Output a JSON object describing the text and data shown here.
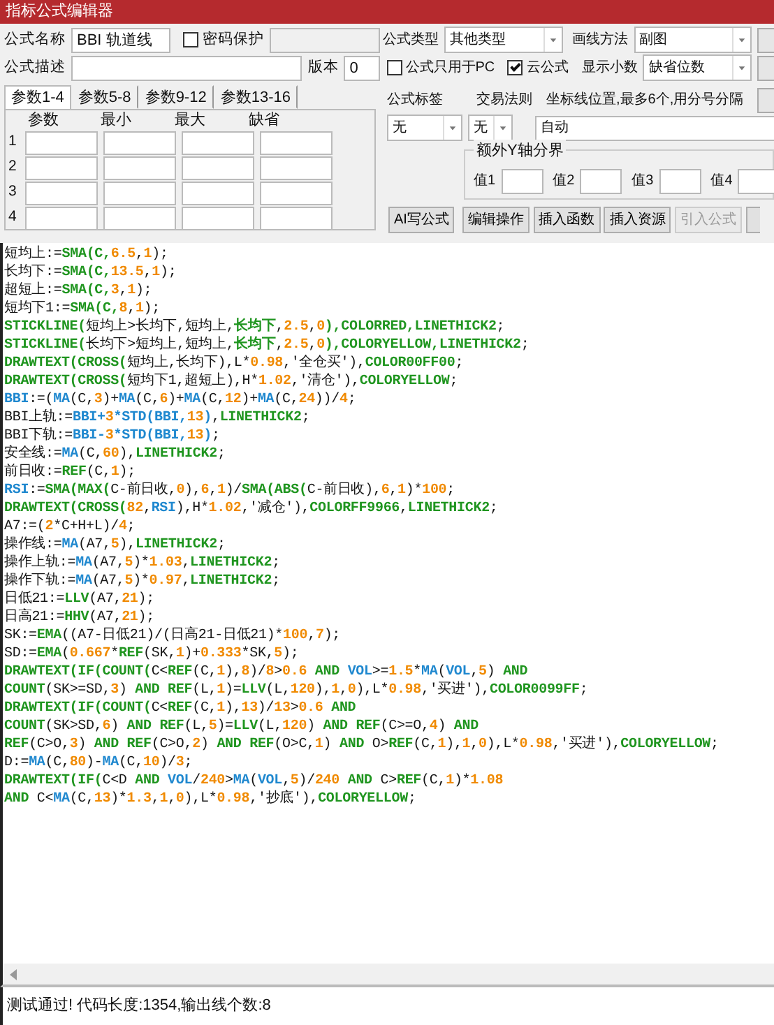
{
  "window": {
    "title": "指标公式编辑器"
  },
  "form": {
    "name": {
      "label": "公式名称",
      "value": "BBI 轨道线"
    },
    "password": {
      "label": "密码保护",
      "checked": false
    },
    "description": {
      "label": "公式描述"
    },
    "version": {
      "label": "版本",
      "value": "0"
    },
    "type": {
      "label": "公式类型",
      "value": "其他类型"
    },
    "draw_method": {
      "label": "画线方法",
      "value": "副图"
    },
    "pc_only": {
      "label": "公式只用于PC",
      "checked": false
    },
    "cloud": {
      "label": "云公式",
      "checked": true
    },
    "decimals": {
      "label": "显示小数",
      "value": "缺省位数"
    },
    "tag": {
      "label": "公式标签",
      "value": "无"
    },
    "trade_rule": {
      "label": "交易法则",
      "value": "无"
    },
    "axis_position": {
      "label": "坐标线位置,最多6个,用分号分隔",
      "value": "自动"
    }
  },
  "param_tabs": [
    {
      "label": "参数1-4",
      "selected": true
    },
    {
      "label": "参数5-8",
      "selected": false
    },
    {
      "label": "参数9-12",
      "selected": false
    },
    {
      "label": "参数13-16",
      "selected": false
    }
  ],
  "param_table": {
    "columns": [
      "参数",
      "最小",
      "最大",
      "缺省"
    ],
    "rows": [
      "1",
      "2",
      "3",
      "4"
    ]
  },
  "y_axis_bounds": {
    "legend": "额外Y轴分界",
    "fields": [
      "值1",
      "值2",
      "值3",
      "值4"
    ]
  },
  "buttons": [
    {
      "label": "AI写公式",
      "disabled": false
    },
    {
      "label": "编辑操作",
      "disabled": false
    },
    {
      "label": "插入函数",
      "disabled": false
    },
    {
      "label": "插入资源",
      "disabled": false
    },
    {
      "label": "引入公式",
      "disabled": true
    }
  ],
  "code_lines": [
    [
      {
        "kind": "plain",
        "text": "短均上:="
      },
      {
        "kind": "function",
        "text": "SMA(C,"
      },
      {
        "kind": "number",
        "text": "6.5"
      },
      {
        "kind": "plain",
        "text": ","
      },
      {
        "kind": "number",
        "text": "1"
      },
      {
        "kind": "plain",
        "text": ");"
      }
    ],
    [
      {
        "kind": "plain",
        "text": "长均下:="
      },
      {
        "kind": "function",
        "text": "SMA(C,"
      },
      {
        "kind": "number",
        "text": "13.5"
      },
      {
        "kind": "plain",
        "text": ","
      },
      {
        "kind": "number",
        "text": "1"
      },
      {
        "kind": "plain",
        "text": ");"
      }
    ],
    [
      {
        "kind": "plain",
        "text": "超短上:="
      },
      {
        "kind": "function",
        "text": "SMA(C,"
      },
      {
        "kind": "number",
        "text": "3"
      },
      {
        "kind": "plain",
        "text": ","
      },
      {
        "kind": "number",
        "text": "1"
      },
      {
        "kind": "plain",
        "text": ");"
      }
    ],
    [
      {
        "kind": "plain",
        "text": "短均下1:="
      },
      {
        "kind": "function",
        "text": "SMA(C,"
      },
      {
        "kind": "number",
        "text": "8"
      },
      {
        "kind": "plain",
        "text": ","
      },
      {
        "kind": "number",
        "text": "1"
      },
      {
        "kind": "plain",
        "text": ");"
      }
    ],
    [
      {
        "kind": "function",
        "text": "STICKLINE("
      },
      {
        "kind": "plain",
        "text": "短均上>长均下,短均上,"
      },
      {
        "kind": "function",
        "text": "长均下"
      },
      {
        "kind": "plain",
        "text": ","
      },
      {
        "kind": "number",
        "text": "2.5"
      },
      {
        "kind": "plain",
        "text": ","
      },
      {
        "kind": "number",
        "text": "0"
      },
      {
        "kind": "function",
        "text": "),COLORRED,LINETHICK2"
      },
      {
        "kind": "plain",
        "text": ";"
      }
    ],
    [
      {
        "kind": "function",
        "text": "STICKLINE("
      },
      {
        "kind": "plain",
        "text": "长均下>短均上,短均上,"
      },
      {
        "kind": "function",
        "text": "长均下"
      },
      {
        "kind": "plain",
        "text": ","
      },
      {
        "kind": "number",
        "text": "2.5"
      },
      {
        "kind": "plain",
        "text": ","
      },
      {
        "kind": "number",
        "text": "0"
      },
      {
        "kind": "function",
        "text": "),COLORYELLOW,LINETHICK2"
      },
      {
        "kind": "plain",
        "text": ";"
      }
    ],
    [
      {
        "kind": "function",
        "text": "DRAWTEXT(CROSS("
      },
      {
        "kind": "plain",
        "text": "短均上,长均下),L*"
      },
      {
        "kind": "number",
        "text": "0.98"
      },
      {
        "kind": "plain",
        "text": ",'全仓买'),"
      },
      {
        "kind": "function",
        "text": "COLOR00FF00"
      },
      {
        "kind": "plain",
        "text": ";"
      }
    ],
    [
      {
        "kind": "function",
        "text": "DRAWTEXT(CROSS("
      },
      {
        "kind": "plain",
        "text": "短均下1,超短上),H*"
      },
      {
        "kind": "number",
        "text": "1.02"
      },
      {
        "kind": "plain",
        "text": ",'清仓'),"
      },
      {
        "kind": "function",
        "text": "COLORYELLOW"
      },
      {
        "kind": "plain",
        "text": ";"
      }
    ],
    [
      {
        "kind": "variable",
        "text": "BBI"
      },
      {
        "kind": "plain",
        "text": ":=("
      },
      {
        "kind": "variable",
        "text": "MA"
      },
      {
        "kind": "plain",
        "text": "(C,"
      },
      {
        "kind": "number",
        "text": "3"
      },
      {
        "kind": "plain",
        "text": ")+"
      },
      {
        "kind": "variable",
        "text": "MA"
      },
      {
        "kind": "plain",
        "text": "(C,"
      },
      {
        "kind": "number",
        "text": "6"
      },
      {
        "kind": "plain",
        "text": ")+"
      },
      {
        "kind": "variable",
        "text": "MA"
      },
      {
        "kind": "plain",
        "text": "(C,"
      },
      {
        "kind": "number",
        "text": "12"
      },
      {
        "kind": "plain",
        "text": ")+"
      },
      {
        "kind": "variable",
        "text": "MA"
      },
      {
        "kind": "plain",
        "text": "(C,"
      },
      {
        "kind": "number",
        "text": "24"
      },
      {
        "kind": "plain",
        "text": "))/"
      },
      {
        "kind": "number",
        "text": "4"
      },
      {
        "kind": "plain",
        "text": ";"
      }
    ],
    [
      {
        "kind": "plain",
        "text": "BBI上轨:="
      },
      {
        "kind": "variable",
        "text": "BBI+"
      },
      {
        "kind": "number",
        "text": "3"
      },
      {
        "kind": "variable",
        "text": "*STD(BBI,"
      },
      {
        "kind": "number",
        "text": "13"
      },
      {
        "kind": "variable",
        "text": ")"
      },
      {
        "kind": "plain",
        "text": ","
      },
      {
        "kind": "function",
        "text": "LINETHICK2"
      },
      {
        "kind": "plain",
        "text": ";"
      }
    ],
    [
      {
        "kind": "plain",
        "text": "BBI下轨:="
      },
      {
        "kind": "variable",
        "text": "BBI-"
      },
      {
        "kind": "number",
        "text": "3"
      },
      {
        "kind": "variable",
        "text": "*STD(BBI,"
      },
      {
        "kind": "number",
        "text": "13"
      },
      {
        "kind": "variable",
        "text": ")"
      },
      {
        "kind": "plain",
        "text": ";"
      }
    ],
    [
      {
        "kind": "plain",
        "text": "安全线:="
      },
      {
        "kind": "variable",
        "text": "MA"
      },
      {
        "kind": "plain",
        "text": "(C,"
      },
      {
        "kind": "number",
        "text": "60"
      },
      {
        "kind": "plain",
        "text": "),"
      },
      {
        "kind": "function",
        "text": "LINETHICK2"
      },
      {
        "kind": "plain",
        "text": ";"
      }
    ],
    [
      {
        "kind": "plain",
        "text": "前日收:="
      },
      {
        "kind": "function",
        "text": "REF"
      },
      {
        "kind": "plain",
        "text": "(C,"
      },
      {
        "kind": "number",
        "text": "1"
      },
      {
        "kind": "plain",
        "text": ");"
      }
    ],
    [
      {
        "kind": "variable",
        "text": "RSI"
      },
      {
        "kind": "plain",
        "text": ":="
      },
      {
        "kind": "function",
        "text": "SMA(MAX("
      },
      {
        "kind": "plain",
        "text": "C-前日收,"
      },
      {
        "kind": "number",
        "text": "0"
      },
      {
        "kind": "plain",
        "text": "),"
      },
      {
        "kind": "number",
        "text": "6"
      },
      {
        "kind": "plain",
        "text": ","
      },
      {
        "kind": "number",
        "text": "1"
      },
      {
        "kind": "plain",
        "text": ")/"
      },
      {
        "kind": "function",
        "text": "SMA(ABS("
      },
      {
        "kind": "plain",
        "text": "C-前日收),"
      },
      {
        "kind": "number",
        "text": "6"
      },
      {
        "kind": "plain",
        "text": ","
      },
      {
        "kind": "number",
        "text": "1"
      },
      {
        "kind": "plain",
        "text": ")*"
      },
      {
        "kind": "number",
        "text": "100"
      },
      {
        "kind": "plain",
        "text": ";"
      }
    ],
    [
      {
        "kind": "function",
        "text": "DRAWTEXT(CROSS("
      },
      {
        "kind": "number",
        "text": "82"
      },
      {
        "kind": "plain",
        "text": ","
      },
      {
        "kind": "variable",
        "text": "RSI"
      },
      {
        "kind": "plain",
        "text": "),H*"
      },
      {
        "kind": "number",
        "text": "1.02"
      },
      {
        "kind": "plain",
        "text": ",'减仓'),"
      },
      {
        "kind": "function",
        "text": "COLORFF9966"
      },
      {
        "kind": "plain",
        "text": ","
      },
      {
        "kind": "function",
        "text": "LINETHICK2"
      },
      {
        "kind": "plain",
        "text": ";"
      }
    ],
    [
      {
        "kind": "plain",
        "text": "A7:=("
      },
      {
        "kind": "number",
        "text": "2"
      },
      {
        "kind": "plain",
        "text": "*C+H+L)/"
      },
      {
        "kind": "number",
        "text": "4"
      },
      {
        "kind": "plain",
        "text": ";"
      }
    ],
    [
      {
        "kind": "plain",
        "text": "操作线:="
      },
      {
        "kind": "variable",
        "text": "MA"
      },
      {
        "kind": "plain",
        "text": "(A7,"
      },
      {
        "kind": "number",
        "text": "5"
      },
      {
        "kind": "plain",
        "text": "),"
      },
      {
        "kind": "function",
        "text": "LINETHICK2"
      },
      {
        "kind": "plain",
        "text": ";"
      }
    ],
    [
      {
        "kind": "plain",
        "text": "操作上轨:="
      },
      {
        "kind": "variable",
        "text": "MA"
      },
      {
        "kind": "plain",
        "text": "(A7,"
      },
      {
        "kind": "number",
        "text": "5"
      },
      {
        "kind": "plain",
        "text": ")*"
      },
      {
        "kind": "number",
        "text": "1.03"
      },
      {
        "kind": "plain",
        "text": ","
      },
      {
        "kind": "function",
        "text": "LINETHICK2"
      },
      {
        "kind": "plain",
        "text": ";"
      }
    ],
    [
      {
        "kind": "plain",
        "text": "操作下轨:="
      },
      {
        "kind": "variable",
        "text": "MA"
      },
      {
        "kind": "plain",
        "text": "(A7,"
      },
      {
        "kind": "number",
        "text": "5"
      },
      {
        "kind": "plain",
        "text": ")*"
      },
      {
        "kind": "number",
        "text": "0.97"
      },
      {
        "kind": "plain",
        "text": ","
      },
      {
        "kind": "function",
        "text": "LINETHICK2"
      },
      {
        "kind": "plain",
        "text": ";"
      }
    ],
    [
      {
        "kind": "plain",
        "text": "日低21:="
      },
      {
        "kind": "function",
        "text": "LLV"
      },
      {
        "kind": "plain",
        "text": "(A7,"
      },
      {
        "kind": "number",
        "text": "21"
      },
      {
        "kind": "plain",
        "text": ");"
      }
    ],
    [
      {
        "kind": "plain",
        "text": "日高21:="
      },
      {
        "kind": "function",
        "text": "HHV"
      },
      {
        "kind": "plain",
        "text": "(A7,"
      },
      {
        "kind": "number",
        "text": "21"
      },
      {
        "kind": "plain",
        "text": ");"
      }
    ],
    [
      {
        "kind": "plain",
        "text": "SK:="
      },
      {
        "kind": "function",
        "text": "EMA"
      },
      {
        "kind": "plain",
        "text": "((A7-日低21)/(日高21-日低21)*"
      },
      {
        "kind": "number",
        "text": "100"
      },
      {
        "kind": "plain",
        "text": ","
      },
      {
        "kind": "number",
        "text": "7"
      },
      {
        "kind": "plain",
        "text": ");"
      }
    ],
    [
      {
        "kind": "plain",
        "text": "SD:="
      },
      {
        "kind": "function",
        "text": "EMA"
      },
      {
        "kind": "plain",
        "text": "("
      },
      {
        "kind": "number",
        "text": "0.667"
      },
      {
        "kind": "plain",
        "text": "*"
      },
      {
        "kind": "function",
        "text": "REF"
      },
      {
        "kind": "plain",
        "text": "(SK,"
      },
      {
        "kind": "number",
        "text": "1"
      },
      {
        "kind": "plain",
        "text": ")+"
      },
      {
        "kind": "number",
        "text": "0.333"
      },
      {
        "kind": "plain",
        "text": "*SK,"
      },
      {
        "kind": "number",
        "text": "5"
      },
      {
        "kind": "plain",
        "text": ");"
      }
    ],
    [
      {
        "kind": "function",
        "text": "DRAWTEXT(IF(COUNT("
      },
      {
        "kind": "plain",
        "text": "C<"
      },
      {
        "kind": "function",
        "text": "REF"
      },
      {
        "kind": "plain",
        "text": "(C,"
      },
      {
        "kind": "number",
        "text": "1"
      },
      {
        "kind": "plain",
        "text": "),"
      },
      {
        "kind": "number",
        "text": "8"
      },
      {
        "kind": "plain",
        "text": ")/"
      },
      {
        "kind": "number",
        "text": "8"
      },
      {
        "kind": "plain",
        "text": ">"
      },
      {
        "kind": "number",
        "text": "0.6"
      },
      {
        "kind": "function",
        "text": " AND "
      },
      {
        "kind": "variable",
        "text": "VOL"
      },
      {
        "kind": "plain",
        "text": ">="
      },
      {
        "kind": "number",
        "text": "1.5"
      },
      {
        "kind": "plain",
        "text": "*"
      },
      {
        "kind": "variable",
        "text": "MA"
      },
      {
        "kind": "plain",
        "text": "("
      },
      {
        "kind": "variable",
        "text": "VOL"
      },
      {
        "kind": "plain",
        "text": ","
      },
      {
        "kind": "number",
        "text": "5"
      },
      {
        "kind": "plain",
        "text": ")"
      },
      {
        "kind": "function",
        "text": " AND"
      }
    ],
    [
      {
        "kind": "function",
        "text": "COUNT"
      },
      {
        "kind": "plain",
        "text": "(SK>=SD,"
      },
      {
        "kind": "number",
        "text": "3"
      },
      {
        "kind": "plain",
        "text": ")"
      },
      {
        "kind": "function",
        "text": " AND REF"
      },
      {
        "kind": "plain",
        "text": "(L,"
      },
      {
        "kind": "number",
        "text": "1"
      },
      {
        "kind": "plain",
        "text": ")="
      },
      {
        "kind": "function",
        "text": "LLV"
      },
      {
        "kind": "plain",
        "text": "(L,"
      },
      {
        "kind": "number",
        "text": "120"
      },
      {
        "kind": "plain",
        "text": "),"
      },
      {
        "kind": "number",
        "text": "1"
      },
      {
        "kind": "plain",
        "text": ","
      },
      {
        "kind": "number",
        "text": "0"
      },
      {
        "kind": "plain",
        "text": "),L*"
      },
      {
        "kind": "number",
        "text": "0.98"
      },
      {
        "kind": "plain",
        "text": ",'买进'),"
      },
      {
        "kind": "function",
        "text": "COLOR0099FF"
      },
      {
        "kind": "plain",
        "text": ";"
      }
    ],
    [
      {
        "kind": "function",
        "text": "DRAWTEXT(IF(COUNT("
      },
      {
        "kind": "plain",
        "text": "C<"
      },
      {
        "kind": "function",
        "text": "REF"
      },
      {
        "kind": "plain",
        "text": "(C,"
      },
      {
        "kind": "number",
        "text": "1"
      },
      {
        "kind": "plain",
        "text": "),"
      },
      {
        "kind": "number",
        "text": "13"
      },
      {
        "kind": "plain",
        "text": ")/"
      },
      {
        "kind": "number",
        "text": "13"
      },
      {
        "kind": "plain",
        "text": ">"
      },
      {
        "kind": "number",
        "text": "0.6"
      },
      {
        "kind": "function",
        "text": " AND"
      }
    ],
    [
      {
        "kind": "function",
        "text": "COUNT"
      },
      {
        "kind": "plain",
        "text": "(SK>SD,"
      },
      {
        "kind": "number",
        "text": "6"
      },
      {
        "kind": "plain",
        "text": ")"
      },
      {
        "kind": "function",
        "text": " AND REF"
      },
      {
        "kind": "plain",
        "text": "(L,"
      },
      {
        "kind": "number",
        "text": "5"
      },
      {
        "kind": "plain",
        "text": ")="
      },
      {
        "kind": "function",
        "text": "LLV"
      },
      {
        "kind": "plain",
        "text": "(L,"
      },
      {
        "kind": "number",
        "text": "120"
      },
      {
        "kind": "plain",
        "text": ")"
      },
      {
        "kind": "function",
        "text": " AND REF"
      },
      {
        "kind": "plain",
        "text": "(C>=O,"
      },
      {
        "kind": "number",
        "text": "4"
      },
      {
        "kind": "plain",
        "text": ")"
      },
      {
        "kind": "function",
        "text": " AND"
      }
    ],
    [
      {
        "kind": "function",
        "text": "REF"
      },
      {
        "kind": "plain",
        "text": "(C>O,"
      },
      {
        "kind": "number",
        "text": "3"
      },
      {
        "kind": "plain",
        "text": ")"
      },
      {
        "kind": "function",
        "text": " AND REF"
      },
      {
        "kind": "plain",
        "text": "(C>O,"
      },
      {
        "kind": "number",
        "text": "2"
      },
      {
        "kind": "plain",
        "text": ")"
      },
      {
        "kind": "function",
        "text": " AND REF"
      },
      {
        "kind": "plain",
        "text": "(O>C,"
      },
      {
        "kind": "number",
        "text": "1"
      },
      {
        "kind": "plain",
        "text": ")"
      },
      {
        "kind": "function",
        "text": " AND "
      },
      {
        "kind": "plain",
        "text": "O>"
      },
      {
        "kind": "function",
        "text": "REF"
      },
      {
        "kind": "plain",
        "text": "(C,"
      },
      {
        "kind": "number",
        "text": "1"
      },
      {
        "kind": "plain",
        "text": "),"
      },
      {
        "kind": "number",
        "text": "1"
      },
      {
        "kind": "plain",
        "text": ","
      },
      {
        "kind": "number",
        "text": "0"
      },
      {
        "kind": "plain",
        "text": "),L*"
      },
      {
        "kind": "number",
        "text": "0.98"
      },
      {
        "kind": "plain",
        "text": ",'买进'),"
      },
      {
        "kind": "function",
        "text": "COLORYELLOW"
      },
      {
        "kind": "plain",
        "text": ";"
      }
    ],
    [
      {
        "kind": "plain",
        "text": "D:="
      },
      {
        "kind": "variable",
        "text": "MA"
      },
      {
        "kind": "plain",
        "text": "(C,"
      },
      {
        "kind": "number",
        "text": "80"
      },
      {
        "kind": "plain",
        "text": ")-"
      },
      {
        "kind": "variable",
        "text": "MA"
      },
      {
        "kind": "plain",
        "text": "(C,"
      },
      {
        "kind": "number",
        "text": "10"
      },
      {
        "kind": "plain",
        "text": ")/"
      },
      {
        "kind": "number",
        "text": "3"
      },
      {
        "kind": "plain",
        "text": ";"
      }
    ],
    [
      {
        "kind": "function",
        "text": "DRAWTEXT(IF("
      },
      {
        "kind": "plain",
        "text": "C<D"
      },
      {
        "kind": "function",
        "text": " AND "
      },
      {
        "kind": "variable",
        "text": "VOL"
      },
      {
        "kind": "plain",
        "text": "/"
      },
      {
        "kind": "number",
        "text": "240"
      },
      {
        "kind": "plain",
        "text": ">"
      },
      {
        "kind": "variable",
        "text": "MA"
      },
      {
        "kind": "plain",
        "text": "("
      },
      {
        "kind": "variable",
        "text": "VOL"
      },
      {
        "kind": "plain",
        "text": ","
      },
      {
        "kind": "number",
        "text": "5"
      },
      {
        "kind": "plain",
        "text": ")/"
      },
      {
        "kind": "number",
        "text": "240"
      },
      {
        "kind": "function",
        "text": " AND "
      },
      {
        "kind": "plain",
        "text": "C>"
      },
      {
        "kind": "function",
        "text": "REF"
      },
      {
        "kind": "plain",
        "text": "(C,"
      },
      {
        "kind": "number",
        "text": "1"
      },
      {
        "kind": "plain",
        "text": ")*"
      },
      {
        "kind": "number",
        "text": "1.08"
      }
    ],
    [
      {
        "kind": "function",
        "text": "AND "
      },
      {
        "kind": "plain",
        "text": "C<"
      },
      {
        "kind": "variable",
        "text": "MA"
      },
      {
        "kind": "plain",
        "text": "(C,"
      },
      {
        "kind": "number",
        "text": "13"
      },
      {
        "kind": "plain",
        "text": ")*"
      },
      {
        "kind": "number",
        "text": "1.3"
      },
      {
        "kind": "plain",
        "text": ","
      },
      {
        "kind": "number",
        "text": "1"
      },
      {
        "kind": "plain",
        "text": ","
      },
      {
        "kind": "number",
        "text": "0"
      },
      {
        "kind": "plain",
        "text": "),L*"
      },
      {
        "kind": "number",
        "text": "0.98"
      },
      {
        "kind": "plain",
        "text": ",'抄底'),"
      },
      {
        "kind": "function",
        "text": "COLORYELLOW"
      },
      {
        "kind": "plain",
        "text": ";"
      }
    ]
  ],
  "status_bar": "测试通过! 代码长度:1354,输出线个数:8"
}
